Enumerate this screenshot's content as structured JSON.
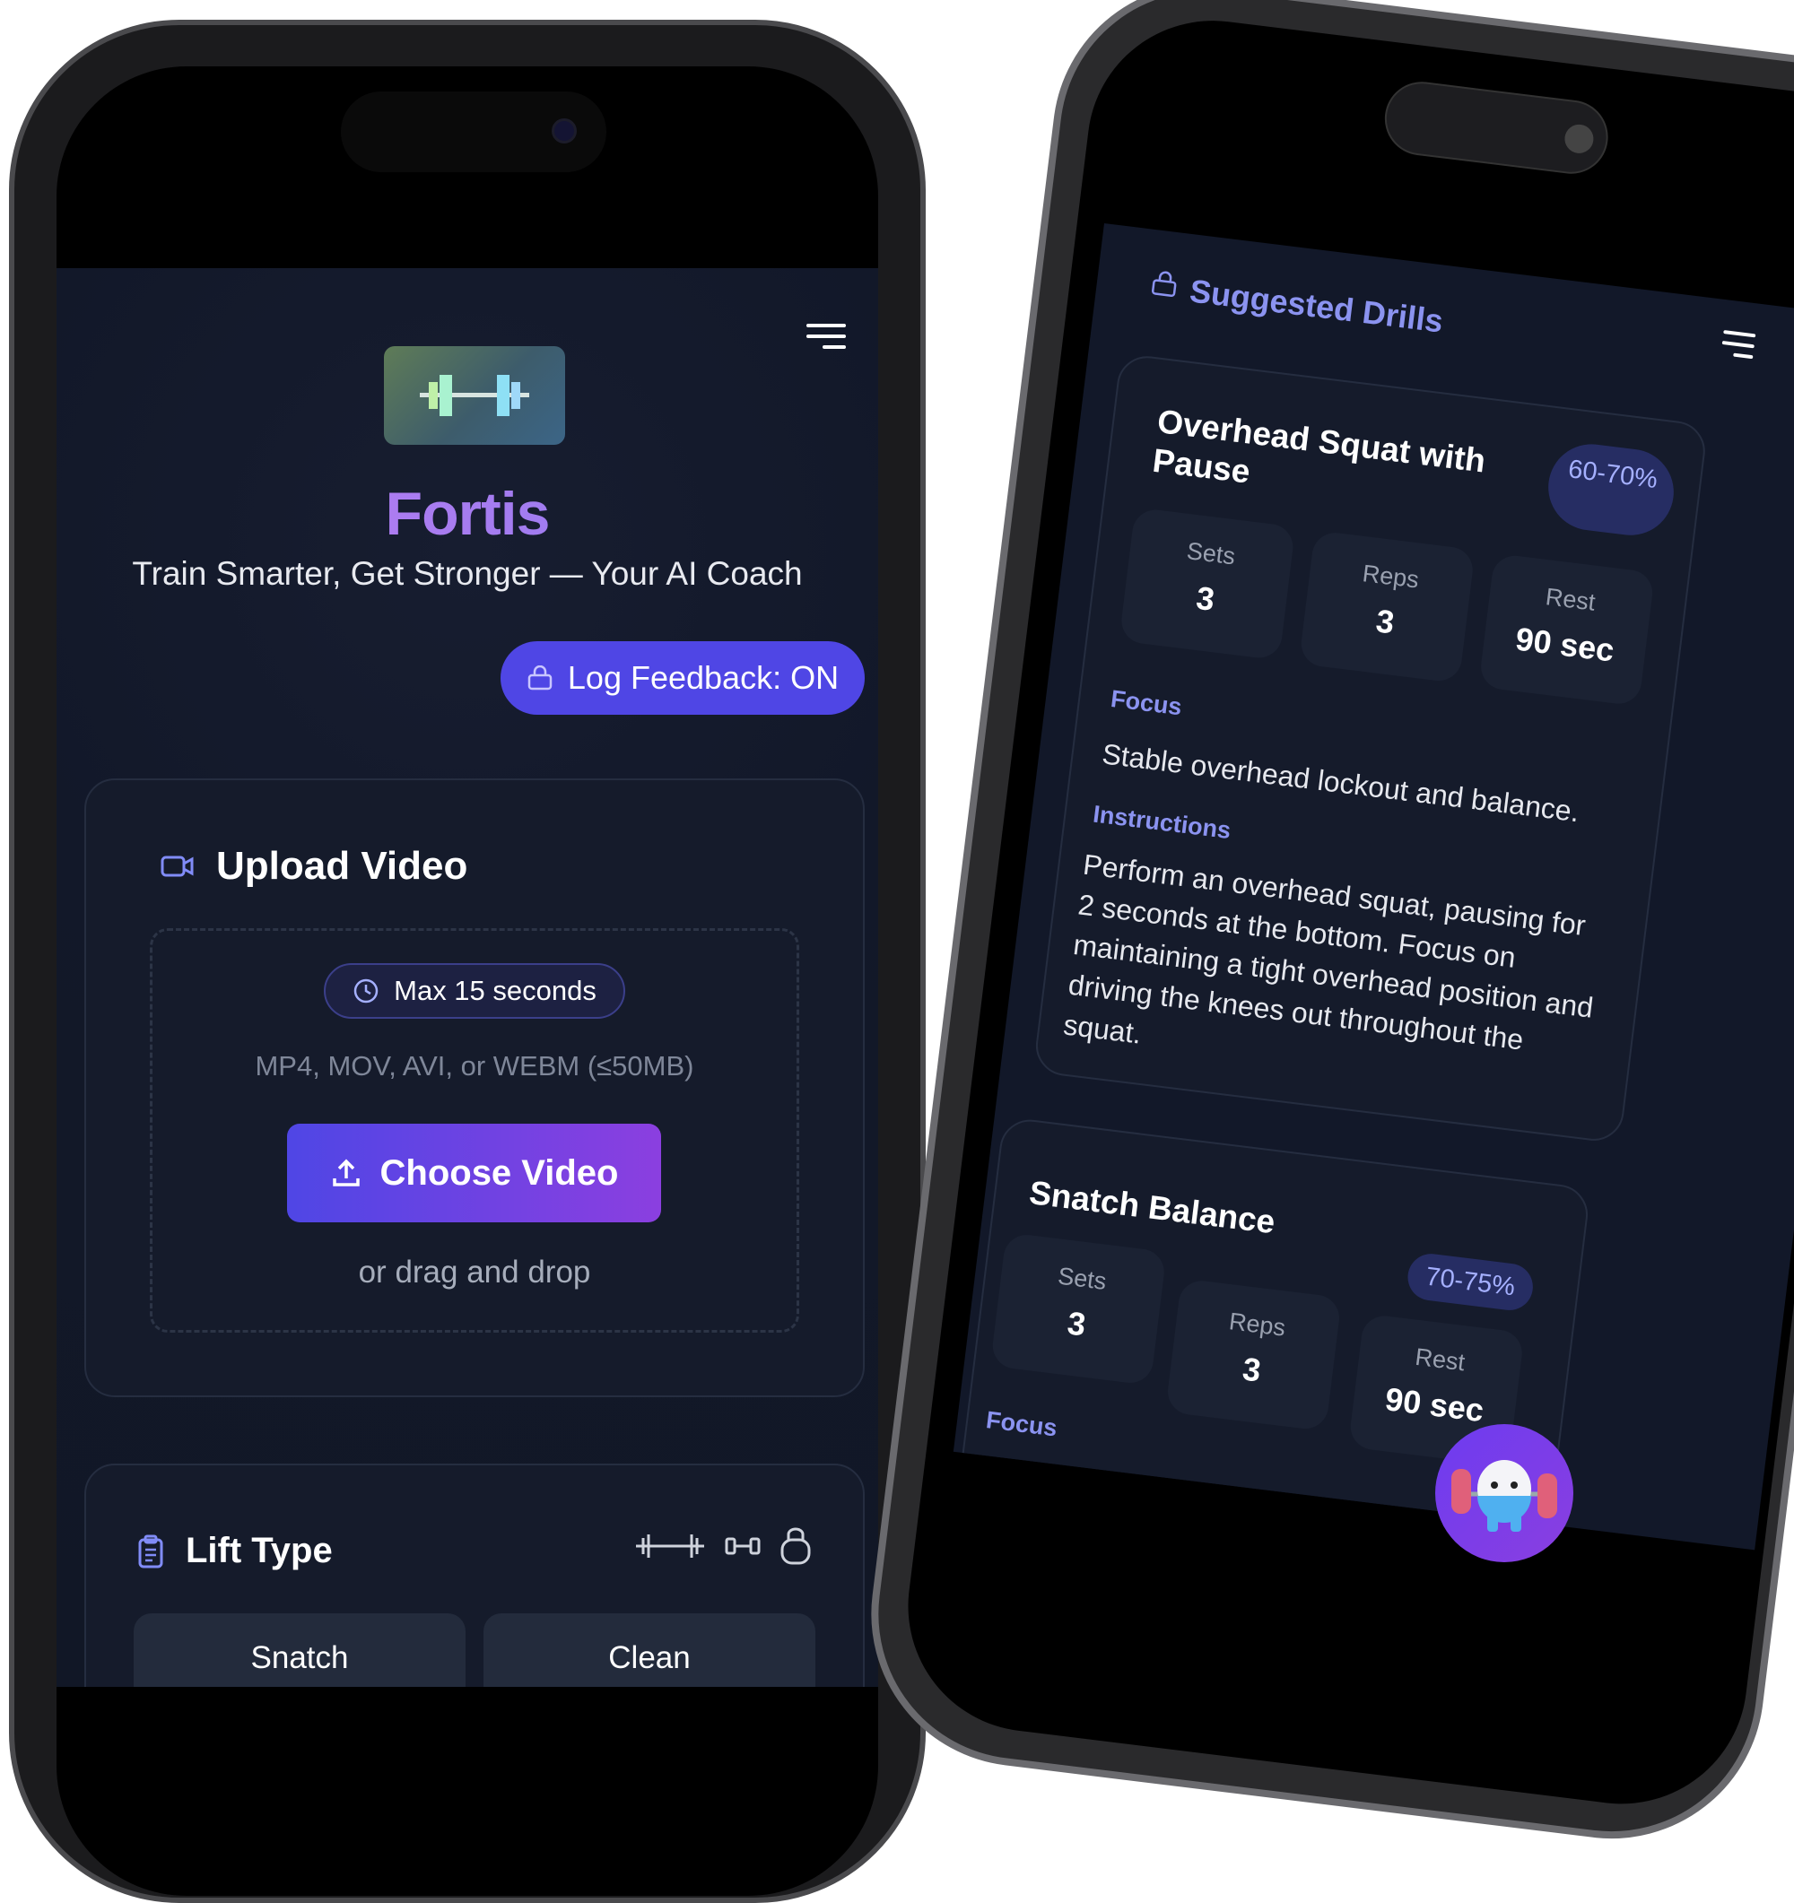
{
  "left_screen": {
    "app_name": "Fortis",
    "tagline": "Train Smarter, Get Stronger — Your AI Coach",
    "log_feedback_label": "Log Feedback: ON",
    "upload": {
      "title": "Upload Video",
      "max_duration": "Max 15 seconds",
      "formats": "MP4, MOV, AVI, or WEBM (≤50MB)",
      "choose_label": "Choose Video",
      "drag_hint": "or drag and drop"
    },
    "lift_type": {
      "title": "Lift Type",
      "options": [
        "Snatch",
        "Clean"
      ]
    }
  },
  "right_screen": {
    "section_title": "Suggested Drills",
    "drills": [
      {
        "title": "Overhead Squat with Pause",
        "intensity": "60-70%",
        "stats": [
          {
            "label": "Sets",
            "value": "3"
          },
          {
            "label": "Reps",
            "value": "3"
          },
          {
            "label": "Rest",
            "value": "90 sec"
          }
        ],
        "focus_label": "Focus",
        "focus": "Stable overhead lockout and balance.",
        "instructions_label": "Instructions",
        "instructions": "Perform an overhead squat, pausing for 2 seconds at the bottom. Focus on maintaining a tight overhead position and driving the knees out throughout the squat."
      },
      {
        "title": "Snatch Balance",
        "intensity": "70-75%",
        "stats": [
          {
            "label": "Sets",
            "value": "3"
          },
          {
            "label": "Reps",
            "value": "3"
          },
          {
            "label": "Rest",
            "value": "90 sec"
          }
        ],
        "focus_label": "Focus"
      }
    ]
  },
  "colors": {
    "accent": "#4f46e5",
    "brand_gradient_start": "#c27cf0",
    "brand_gradient_end": "#8b7cf0",
    "background": "#121829",
    "label_blue": "#8b93f0"
  }
}
